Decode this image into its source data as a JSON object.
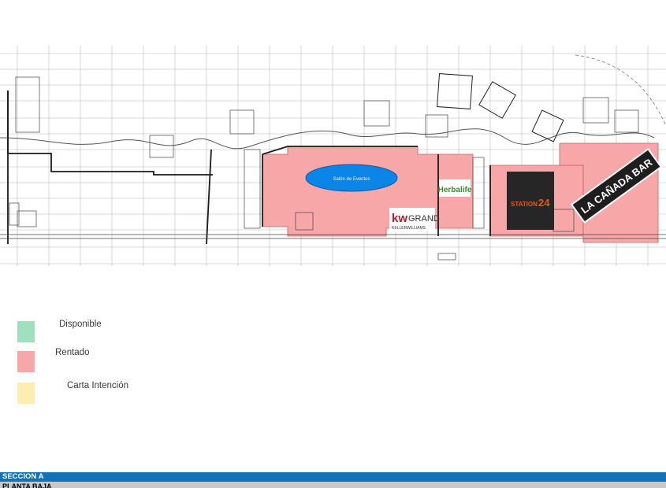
{
  "plan": {
    "event_hall_label": "Salón de Eventos",
    "tenants": {
      "herbalife": "Herbalife",
      "kw_brand": "kw",
      "kw_grand": "GRAND",
      "kw_sub": "KELLERWILLIAMS",
      "station_name": "STATION",
      "station_number": "24",
      "bar_logo": "LA CAÑADA BAR"
    },
    "colors": {
      "rented_fill": "#f7a7a7",
      "event_hall_fill": "#0b86e6",
      "station_bg": "#262626",
      "station_text": "#e8571f",
      "grid_line": "#b8b8b8",
      "wall": "#1a1a1a"
    }
  },
  "legend": [
    {
      "label": "Disponible",
      "color": "#9fe0bd"
    },
    {
      "label": "Rentado",
      "color": "#f7a7a7"
    },
    {
      "label": "Carta Intención",
      "color": "#fdeeb0"
    }
  ],
  "footer": {
    "section": "SECCION A",
    "floor": "PLANTA BAJA"
  }
}
